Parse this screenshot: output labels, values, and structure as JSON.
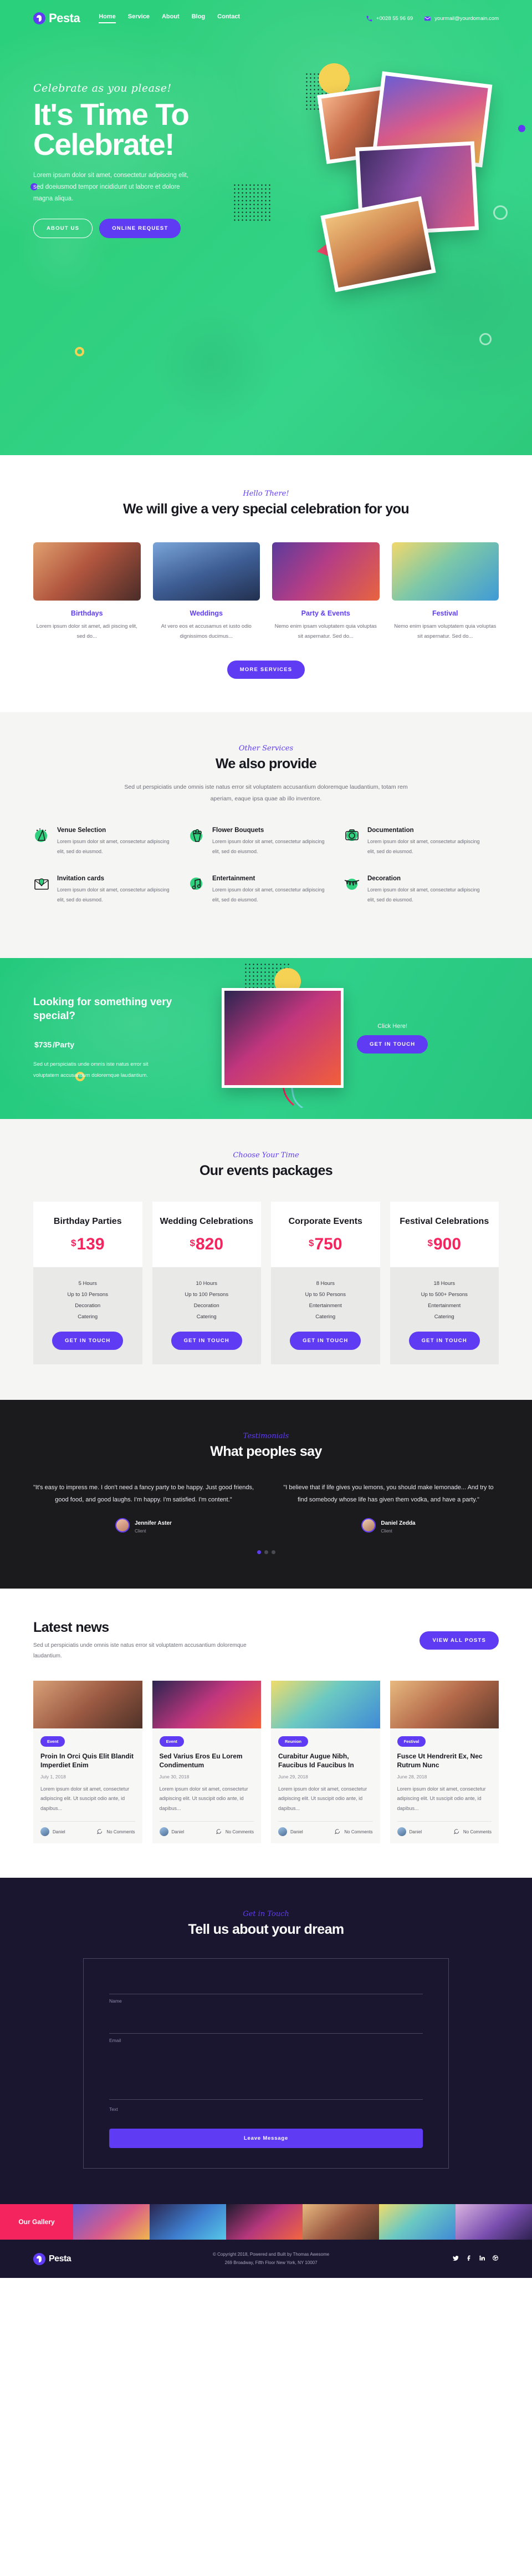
{
  "brand": {
    "name": "Pesta"
  },
  "nav": {
    "links": [
      {
        "label": "Home",
        "active": true
      },
      {
        "label": "Service",
        "active": false
      },
      {
        "label": "About",
        "active": false
      },
      {
        "label": "Blog",
        "active": false
      },
      {
        "label": "Contact",
        "active": false
      }
    ],
    "phone": "+0028 55 96 69",
    "email": "yourmail@yourdomain.com",
    "phone_icon": "phone-icon",
    "email_icon": "envelope-icon"
  },
  "hero": {
    "kicker": "Celebrate as you please!",
    "title_line1": "It's Time To",
    "title_line2": "Celebrate!",
    "description": "Lorem ipsum dolor sit amet, consectetur adipiscing elit, sed doeiusmod tempor incididunt ut labore et dolore magna aliqua.",
    "btn_primary": "ABOUT US",
    "btn_secondary": "ONLINE REQUEST"
  },
  "celebration": {
    "kicker": "Hello There!",
    "title": "We will give a very special celebration for you",
    "categories": [
      {
        "name": "Birthdays",
        "text": "Lorem ipsum dolor sit amet, adi piscing elit, sed do..."
      },
      {
        "name": "Weddings",
        "text": "At vero eos et accusamus et iusto odio dignissimos ducimus..."
      },
      {
        "name": "Party & Events",
        "text": "Nemo enim ipsam voluptatem quia voluptas sit aspernatur. Sed do..."
      },
      {
        "name": "Festival",
        "text": "Nemo enim ipsam voluptatem quia voluptas sit aspernatur. Sed do..."
      }
    ],
    "more_button": "MORE SERVICES"
  },
  "other_services": {
    "kicker": "Other Services",
    "title": "We also provide",
    "description": "Sed ut perspiciatis unde omnis iste natus error sit voluptatem accusantium doloremque laudantium, totam rem aperiam, eaque ipsa quae ab illo inventore.",
    "items": [
      {
        "title": "Venue Selection",
        "text": "Lorem ipsum dolor sit amet, consectetur adipiscing elit, sed do eiusmod.",
        "icon": "venue-icon"
      },
      {
        "title": "Flower Bouquets",
        "text": "Lorem ipsum dolor sit amet, consectetur adipiscing elit, sed do eiusmod.",
        "icon": "bouquet-icon"
      },
      {
        "title": "Documentation",
        "text": "Lorem ipsum dolor sit amet, consectetur adipiscing elit, sed do eiusmod.",
        "icon": "camera-icon"
      },
      {
        "title": "Invitation cards",
        "text": "Lorem ipsum dolor sit amet, consectetur adipiscing elit, sed do eiusmod.",
        "icon": "envelope-card-icon"
      },
      {
        "title": "Entertainment",
        "text": "Lorem ipsum dolor sit amet, consectetur adipiscing elit, sed do eiusmod.",
        "icon": "music-note-icon"
      },
      {
        "title": "Decoration",
        "text": "Lorem ipsum dolor sit amet, consectetur adipiscing elit, sed do eiusmod.",
        "icon": "bunting-icon"
      }
    ]
  },
  "cta": {
    "heading": "Looking for something very special?",
    "price": "$735",
    "price_unit": "/Party",
    "description": "Sed ut perspiciatis unde omnis iste natus error sit voluptatem accusantium doloremque laudantium.",
    "click_here": "Click Here!",
    "button": "GET IN TOUCH"
  },
  "packages": {
    "kicker": "Choose Your Time",
    "title": "Our events packages",
    "items": [
      {
        "name": "Birthday Parties",
        "currency": "$",
        "price": "139",
        "features": [
          "5 Hours",
          "Up to 10 Persons",
          "Decoration",
          "Catering"
        ],
        "button": "GET IN TOUCH"
      },
      {
        "name": "Wedding Celebrations",
        "currency": "$",
        "price": "820",
        "features": [
          "10 Hours",
          "Up to 100 Persons",
          "Decoration",
          "Catering"
        ],
        "button": "GET IN TOUCH"
      },
      {
        "name": "Corporate Events",
        "currency": "$",
        "price": "750",
        "features": [
          "8 Hours",
          "Up to 50 Persons",
          "Entertainment",
          "Catering"
        ],
        "button": "GET IN TOUCH"
      },
      {
        "name": "Festival Celebrations",
        "currency": "$",
        "price": "900",
        "features": [
          "18 Hours",
          "Up to 500+ Persons",
          "Entertainment",
          "Catering"
        ],
        "button": "GET IN TOUCH"
      }
    ]
  },
  "testimonials": {
    "kicker": "Testimonials",
    "title": "What peoples say",
    "items": [
      {
        "quote": "\"It's easy to impress me. I don't need a fancy party to be happy. Just good friends, good food, and good laughs. I'm happy. I'm satisfied. I'm content.\"",
        "name": "Jennifer Aster",
        "role": "Client"
      },
      {
        "quote": "\"I believe that if life gives you lemons, you should make lemonade... And try to find somebody whose life has given them vodka, and have a party.\"",
        "name": "Daniel Zedda",
        "role": "Client"
      }
    ]
  },
  "news": {
    "title": "Latest news",
    "description": "Sed ut perspiciatis unde omnis iste natus error sit voluptatem accusantium doloremque laudantium.",
    "view_all": "VIEW ALL POSTS",
    "posts": [
      {
        "tag": "Event",
        "title": "Proin In Orci Quis Elit Blandit Imperdiet Enim",
        "date": "July 1, 2018",
        "excerpt": "Lorem ipsum dolor sit amet, consectetur adipiscing elit. Ut suscipit odio ante, id dapibus...",
        "author": "Daniel",
        "comments": "No Comments"
      },
      {
        "tag": "Event",
        "title": "Sed Varius Eros Eu Lorem Condimentum",
        "date": "June 30, 2018",
        "excerpt": "Lorem ipsum dolor sit amet, consectetur adipiscing elit. Ut suscipit odio ante, id dapibus...",
        "author": "Daniel",
        "comments": "No Comments"
      },
      {
        "tag": "Reunion",
        "title": "Curabitur Augue Nibh, Faucibus Id Faucibus In",
        "date": "June 29, 2018",
        "excerpt": "Lorem ipsum dolor sit amet, consectetur adipiscing elit. Ut suscipit odio ante, id dapibus...",
        "author": "Daniel",
        "comments": "No Comments"
      },
      {
        "tag": "Festival",
        "title": "Fusce Ut Hendrerit Ex, Nec Rutrum Nunc",
        "date": "June 28, 2018",
        "excerpt": "Lorem ipsum dolor sit amet, consectetur adipiscing elit. Ut suscipit odio ante, id dapibus...",
        "author": "Daniel",
        "comments": "No Comments"
      }
    ]
  },
  "contact": {
    "kicker": "Get in Touch",
    "title": "Tell us about your dream",
    "fields": [
      {
        "label": "Name",
        "value": ""
      },
      {
        "label": "Email",
        "value": ""
      },
      {
        "label": "Text",
        "value": ""
      }
    ],
    "submit": "Leave Message"
  },
  "gallery": {
    "label": "Our Gallery"
  },
  "footer": {
    "brand": "Pesta",
    "copyright": "© Copyright 2018, Powered and Built by Thomas Awesome",
    "address": "269 Broadway, Fifth Floor New York, NY 10007",
    "socials": [
      "twitter-icon",
      "facebook-icon",
      "linkedin-icon",
      "dribbble-icon"
    ]
  },
  "colors": {
    "green": "#2ecf7d",
    "purple": "#5f3cf4",
    "pink": "#f4245e",
    "yellow": "#f6d254",
    "dark": "#1b1630"
  }
}
